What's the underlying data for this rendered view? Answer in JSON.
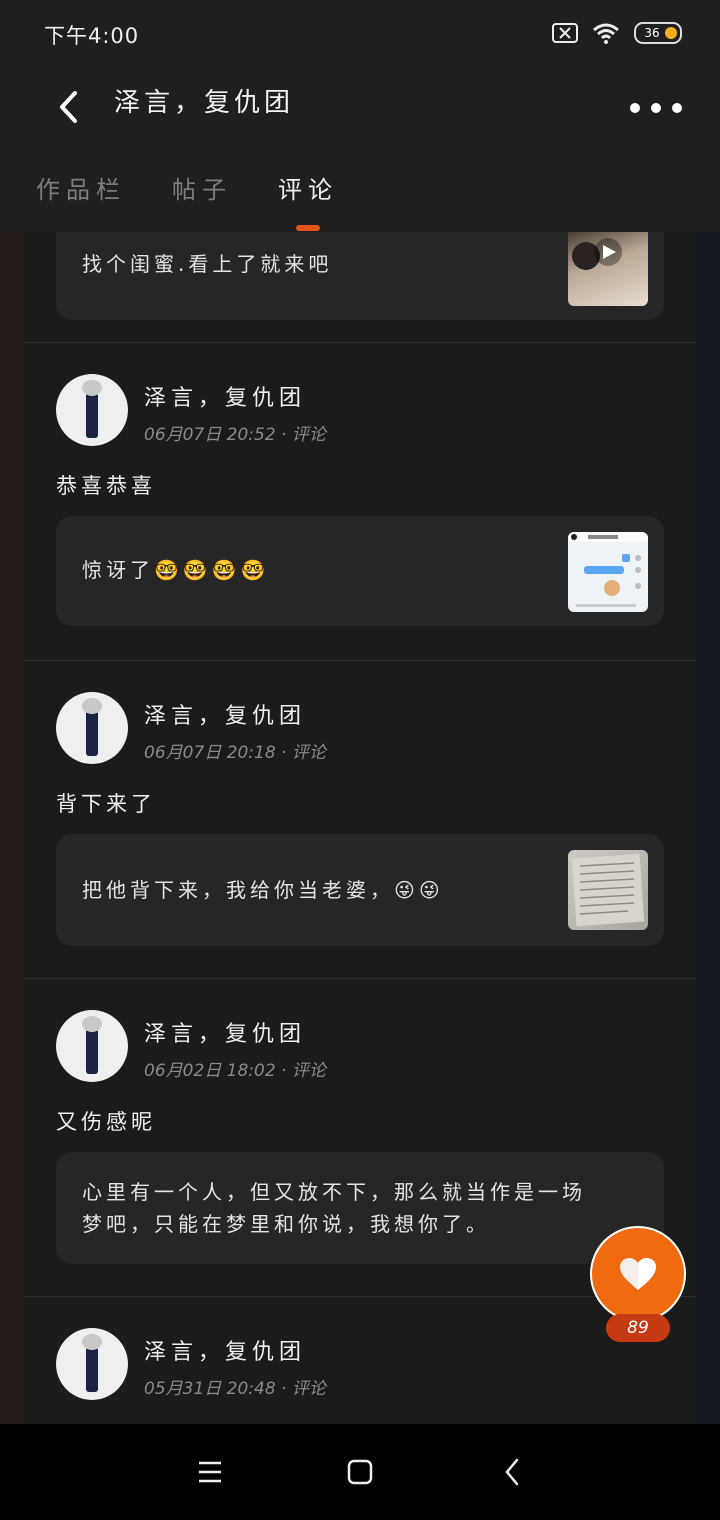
{
  "status_bar": {
    "time": "下午4:00",
    "battery": "36"
  },
  "header": {
    "title": "泽言，复仇团"
  },
  "tabs": [
    {
      "label": "作品栏",
      "active": false
    },
    {
      "label": "帖子",
      "active": false
    },
    {
      "label": "评论",
      "active": true
    }
  ],
  "posts": [
    {
      "quote": "找个闺蜜.看上了就来吧"
    },
    {
      "username": "泽言，复仇团",
      "date": "06月07日 20:52 · 评论",
      "comment": "恭喜恭喜",
      "quote": "惊讶了🤓🤓🤓🤓"
    },
    {
      "username": "泽言，复仇团",
      "date": "06月07日 20:18 · 评论",
      "comment": "背下来了",
      "quote": "把他背下来，我给你当老婆，😜😜"
    },
    {
      "username": "泽言，复仇团",
      "date": "06月02日 18:02 · 评论",
      "comment": "又伤感昵",
      "quote_line1": "心里有一个人，但又放不下，那么就当作是一场",
      "quote_line2": "梦吧，只能在梦里和你说，我想你了。"
    },
    {
      "username": "泽言，复仇团",
      "date": "05月31日 20:48 · 评论"
    }
  ],
  "like": {
    "count": "89"
  },
  "colors": {
    "accent": "#f06a10",
    "tab_indicator": "#e2541c",
    "background": "#1b1b1b"
  },
  "icons": [
    "back-arrow-icon",
    "more-dots-icon",
    "heart-icon",
    "menu-icon",
    "home-square-icon",
    "nav-back-icon",
    "wifi-icon",
    "sim-x-icon"
  ]
}
